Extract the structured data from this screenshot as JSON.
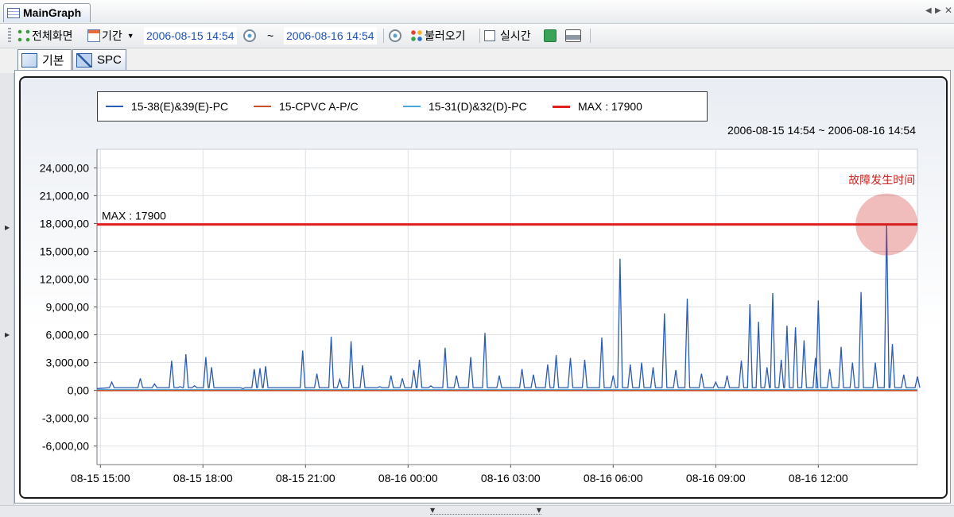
{
  "window": {
    "title": "MainGraph"
  },
  "toolbar": {
    "fullscreen_label": "전체화면",
    "period_label": "기간",
    "start_date": "2006-08-15 14:54",
    "tilde": "~",
    "end_date": "2006-08-16 14:54",
    "load_label": "불러오기",
    "realtime_label": "실시간",
    "realtime_checked": false
  },
  "tabs": [
    {
      "label": "기본",
      "active": true
    },
    {
      "label": "SPC",
      "active": false
    }
  ],
  "colors": {
    "series1": "#2a5bb5",
    "series2": "#c8502a",
    "series3": "#4aa8d8",
    "max": "#e0201e",
    "annotation": "#cc2020"
  },
  "chart_data": {
    "type": "line",
    "date_range_text": "2006-08-15 14:54 ~ 2006-08-16 14:54",
    "x_range": [
      "08-15 14:54",
      "08-16 14:54"
    ],
    "x_ticks": [
      "08-15 15:00",
      "08-15 18:00",
      "08-15 21:00",
      "08-16 00:00",
      "08-16 03:00",
      "08-16 06:00",
      "08-16 09:00",
      "08-16 12:00"
    ],
    "y_ticks": [
      "24,000,00",
      "21,000,00",
      "18,000,00",
      "15,000,00",
      "12,000,00",
      "9,000,00",
      "6,000,00",
      "3,000,00",
      "0,00",
      "-3,000,00",
      "-6,000,00"
    ],
    "ylim": [
      -8000,
      26000
    ],
    "grid": true,
    "legend_position": "top",
    "series": [
      {
        "name": "15-38(E)&39(E)-PC",
        "points": [
          [
            "08-15 14:54",
            200
          ],
          [
            "08-15 15:20",
            900
          ],
          [
            "08-15 15:50",
            300
          ],
          [
            "08-15 16:10",
            1300
          ],
          [
            "08-15 16:35",
            700
          ],
          [
            "08-15 17:05",
            3200
          ],
          [
            "08-15 17:20",
            400
          ],
          [
            "08-15 17:30",
            3900
          ],
          [
            "08-15 17:45",
            500
          ],
          [
            "08-15 18:05",
            3600
          ],
          [
            "08-15 18:15",
            2500
          ],
          [
            "08-15 18:40",
            300
          ],
          [
            "08-15 19:10",
            200
          ],
          [
            "08-15 19:30",
            2300
          ],
          [
            "08-15 19:40",
            2400
          ],
          [
            "08-15 19:50",
            2600
          ],
          [
            "08-15 20:30",
            300
          ],
          [
            "08-15 20:55",
            4300
          ],
          [
            "08-15 21:20",
            1800
          ],
          [
            "08-15 21:45",
            5800
          ],
          [
            "08-15 22:00",
            1200
          ],
          [
            "08-15 22:20",
            5300
          ],
          [
            "08-15 22:40",
            2700
          ],
          [
            "08-15 23:10",
            400
          ],
          [
            "08-15 23:30",
            1600
          ],
          [
            "08-15 23:50",
            1300
          ],
          [
            "08-16 00:10",
            2200
          ],
          [
            "08-16 00:20",
            3300
          ],
          [
            "08-16 00:40",
            500
          ],
          [
            "08-16 01:05",
            4600
          ],
          [
            "08-16 01:25",
            1600
          ],
          [
            "08-16 01:50",
            3600
          ],
          [
            "08-16 02:15",
            6200
          ],
          [
            "08-16 02:40",
            1600
          ],
          [
            "08-16 03:20",
            2300
          ],
          [
            "08-16 03:40",
            1700
          ],
          [
            "08-16 04:05",
            2800
          ],
          [
            "08-16 04:20",
            3800
          ],
          [
            "08-16 04:45",
            3500
          ],
          [
            "08-16 05:10",
            3300
          ],
          [
            "08-16 05:40",
            5700
          ],
          [
            "08-16 06:00",
            1600
          ],
          [
            "08-16 06:12",
            14200
          ],
          [
            "08-16 06:30",
            2800
          ],
          [
            "08-16 06:50",
            3000
          ],
          [
            "08-16 07:10",
            2500
          ],
          [
            "08-16 07:30",
            8300
          ],
          [
            "08-16 07:50",
            2200
          ],
          [
            "08-16 08:10",
            9900
          ],
          [
            "08-16 08:35",
            1800
          ],
          [
            "08-16 09:00",
            900
          ],
          [
            "08-16 09:20",
            1600
          ],
          [
            "08-16 09:45",
            3200
          ],
          [
            "08-16 10:00",
            9300
          ],
          [
            "08-16 10:15",
            7400
          ],
          [
            "08-16 10:30",
            2500
          ],
          [
            "08-16 10:40",
            10500
          ],
          [
            "08-16 10:55",
            3300
          ],
          [
            "08-16 11:05",
            7000
          ],
          [
            "08-16 11:20",
            6800
          ],
          [
            "08-16 11:35",
            5400
          ],
          [
            "08-16 11:55",
            3500
          ],
          [
            "08-16 12:00",
            9700
          ],
          [
            "08-16 12:20",
            2300
          ],
          [
            "08-16 12:40",
            4700
          ],
          [
            "08-16 13:00",
            3000
          ],
          [
            "08-16 13:15",
            10600
          ],
          [
            "08-16 13:40",
            3000
          ],
          [
            "08-16 14:00",
            17800
          ],
          [
            "08-16 14:10",
            5000
          ],
          [
            "08-16 14:30",
            1700
          ],
          [
            "08-16 14:54",
            1500
          ]
        ]
      },
      {
        "name": "15-CPVC A-P/C",
        "points": [
          [
            "08-15 14:54",
            0
          ],
          [
            "08-16 14:54",
            0
          ]
        ]
      },
      {
        "name": "15-31(D)&32(D)-PC",
        "points": [
          [
            "08-15 14:54",
            100
          ],
          [
            "08-16 14:54",
            100
          ]
        ]
      },
      {
        "name": "MAX : 17900",
        "value": 17900
      }
    ],
    "max_line_label": "MAX : 17900",
    "annotation": {
      "text": "故障发生时间",
      "x": "08-16 14:00",
      "y": 17900
    }
  }
}
